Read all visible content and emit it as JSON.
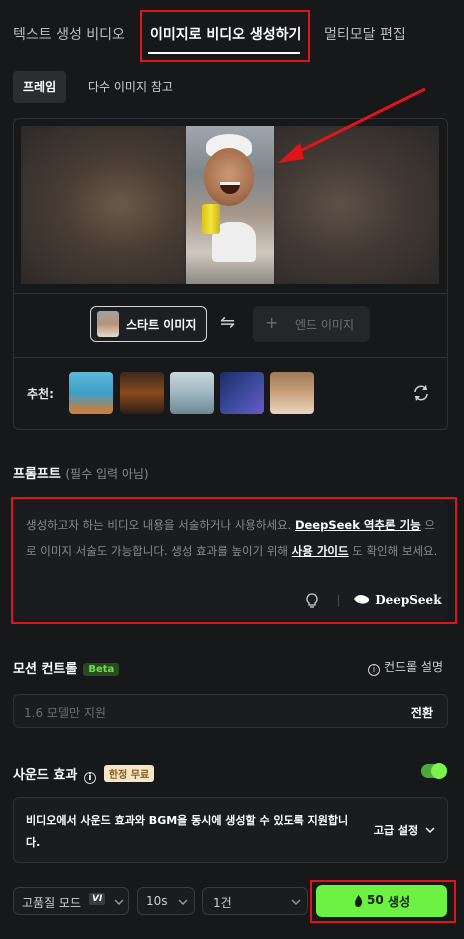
{
  "tabs": [
    {
      "label": "텍스트 생성 비디오"
    },
    {
      "label": "이미지로 비디오 생성하기"
    },
    {
      "label": "멀티모달 편집"
    }
  ],
  "sub_tabs": [
    {
      "label": "프레임"
    },
    {
      "label": "다수 이미지 참고"
    }
  ],
  "frame": {
    "start_label": "스타트 이미지",
    "swap_icon": "⇋",
    "end_plus": "+",
    "end_label": "엔드 이미지"
  },
  "recommend": {
    "label": "추천:",
    "thumb_colors": [
      "#3aa0c8",
      "#5a3a24",
      "#9fb6c2",
      "#3a4a9a",
      "#c9a27a"
    ]
  },
  "prompt": {
    "title": "프롬프트",
    "hint": "(필수 입력 아님)",
    "text_1": "생성하고자 하는 비디오 내용을 서술하거나 사용하세요. ",
    "link_1": "DeepSeek 역추론 기능",
    "text_2": " 으로 이미지 서술도 가능합니다. 생성 효과를 높이기 위해 ",
    "link_2": "사용 가이드",
    "text_3": " 도 확인해 보세요.",
    "deepseek_label": "DeepSeek"
  },
  "motion": {
    "title": "모션 컨트롤",
    "badge": "Beta",
    "info_label": "컨드롤 설명",
    "placeholder": "1.6 모델만 지원",
    "switch_label": "전환"
  },
  "sound": {
    "title": "사운드 효과",
    "badge": "한정 무료",
    "description": "비디오에서 사운드 효과와 BGM을 동시에 생성할 수 있도록 지원합니다.",
    "advanced_label": "고급 설정"
  },
  "bottom": {
    "quality_label": "고품질 모드",
    "quality_badge": "VI",
    "duration": "10s",
    "count": "1건",
    "credits": "50",
    "generate_label": "생성"
  },
  "colors": {
    "accent_green": "#6df243",
    "annotation_red": "#e0151b"
  }
}
